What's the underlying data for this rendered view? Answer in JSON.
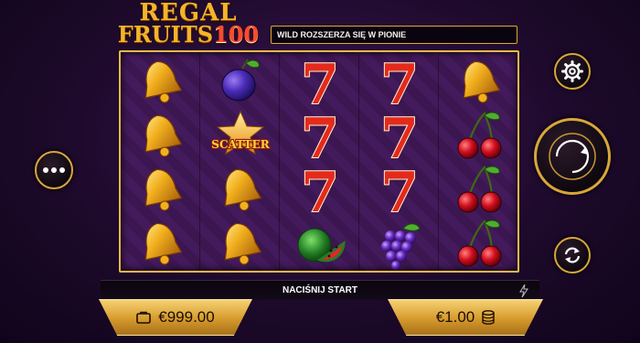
{
  "game": {
    "title_line1": "REGAL",
    "title_line2": "FRUITS",
    "title_number": "100"
  },
  "info_bar": {
    "text": "WILD ROZSZERZA SIĘ W PIONIE"
  },
  "reels": [
    {
      "symbols": [
        "bell",
        "bell",
        "bell",
        "bell"
      ]
    },
    {
      "symbols": [
        "plum",
        "scatter",
        "bell",
        "bell"
      ]
    },
    {
      "symbols": [
        "seven",
        "seven",
        "seven",
        "watermelon"
      ]
    },
    {
      "symbols": [
        "seven",
        "seven",
        "seven",
        "grapes"
      ]
    },
    {
      "symbols": [
        "bell",
        "cherries",
        "cherries",
        "cherries"
      ]
    }
  ],
  "scatter_label": "SCATTER",
  "seven_glyph": "7",
  "status": {
    "text": "NACIŚNIJ START"
  },
  "balance": {
    "value": "€999.00",
    "icon": "wallet-icon"
  },
  "bet": {
    "value": "€1.00",
    "icon": "coins-icon"
  },
  "controls": {
    "menu_icon": "more-dots-icon",
    "settings_icon": "gear-icon",
    "spin_icon": "spin-arrow-icon",
    "autoplay_icon": "autoplay-icon",
    "turbo_icon": "lightning-icon"
  },
  "colors": {
    "accent_gold": "#e9b84a",
    "background": "#2a0e3a",
    "seven_red": "#e52a1c"
  }
}
